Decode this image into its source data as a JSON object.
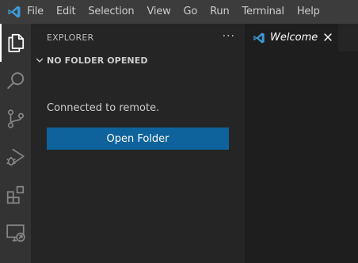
{
  "menu": {
    "items": [
      "File",
      "Edit",
      "Selection",
      "View",
      "Go",
      "Run",
      "Terminal",
      "Help"
    ]
  },
  "activity_bar": {
    "items": [
      {
        "name": "explorer-icon",
        "active": true
      },
      {
        "name": "search-icon",
        "active": false
      },
      {
        "name": "source-control-icon",
        "active": false
      },
      {
        "name": "run-debug-icon",
        "active": false
      },
      {
        "name": "extensions-icon",
        "active": false
      },
      {
        "name": "remote-explorer-icon",
        "active": false
      }
    ]
  },
  "sidebar": {
    "title": "EXPLORER",
    "more_actions": "···",
    "section_title": "NO FOLDER OPENED",
    "message": "Connected to remote.",
    "open_folder_label": "Open Folder"
  },
  "tabs": [
    {
      "label": "Welcome",
      "active": true
    }
  ],
  "colors": {
    "titlebar": "#3c3c3c",
    "activitybar": "#333333",
    "sidebar": "#252526",
    "editor": "#1e1e1e",
    "button": "#0e639c",
    "accent": "#3c99d4"
  }
}
